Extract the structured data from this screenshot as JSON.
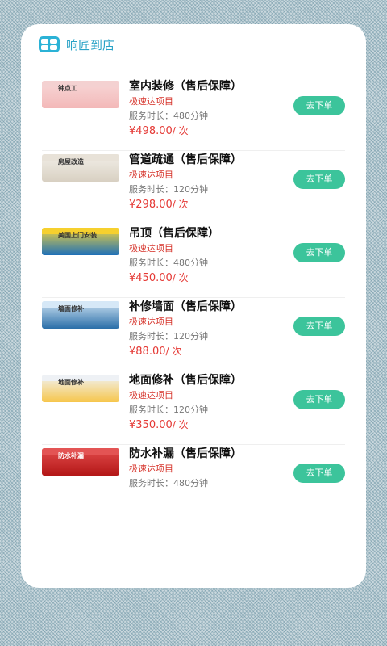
{
  "header": {
    "title": "响匠到店"
  },
  "items": [
    {
      "title": "室内装修（售后保障）",
      "tag": "极速达项目",
      "duration": "服务时长：480分钟",
      "price": "¥498.00",
      "unit": "/ 次",
      "button": "去下单",
      "thumb_text": "钟点工"
    },
    {
      "title": "管道疏通（售后保障）",
      "tag": "极速达项目",
      "duration": "服务时长：120分钟",
      "price": "¥298.00",
      "unit": "/ 次",
      "button": "去下单",
      "thumb_text": "房屋改造"
    },
    {
      "title": "吊顶（售后保障）",
      "tag": "极速达项目",
      "duration": "服务时长：480分钟",
      "price": "¥450.00",
      "unit": "/ 次",
      "button": "去下单",
      "thumb_text": "美国上门安装"
    },
    {
      "title": "补修墙面（售后保障）",
      "tag": "极速达项目",
      "duration": "服务时长：120分钟",
      "price": "¥88.00",
      "unit": "/ 次",
      "button": "去下单",
      "thumb_text": "墙面修补"
    },
    {
      "title": "地面修补（售后保障）",
      "tag": "极速达项目",
      "duration": "服务时长：120分钟",
      "price": "¥350.00",
      "unit": "/ 次",
      "button": "去下单",
      "thumb_text": "地面修补"
    },
    {
      "title": "防水补漏（售后保障）",
      "tag": "极速达项目",
      "duration": "服务时长：480分钟",
      "price": "",
      "unit": "",
      "button": "去下单",
      "thumb_text": "防水补漏"
    }
  ],
  "colors": {
    "accent": "#3cc49b",
    "price": "#e53935",
    "tag": "#d6332a",
    "title": "#2aa3c7"
  }
}
